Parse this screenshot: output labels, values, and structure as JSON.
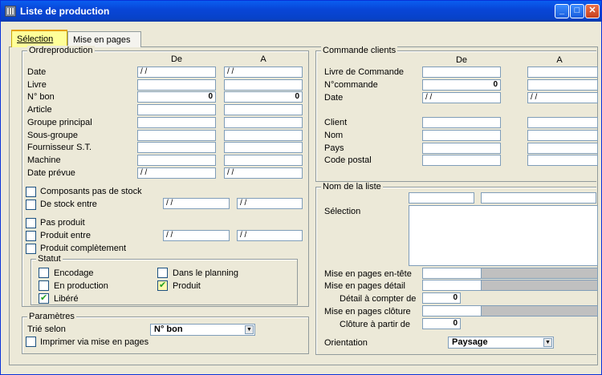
{
  "window": {
    "title": "Liste de production",
    "min": "_",
    "max": "□",
    "close": "✕"
  },
  "tabs": [
    {
      "label": "Sélection"
    },
    {
      "label": "Mise en pages"
    }
  ],
  "ordre": {
    "title": "Ordreproduction",
    "col_de": "De",
    "col_a": "A",
    "rows": [
      {
        "label": "Date",
        "de": " /  /",
        "a": " /  /"
      },
      {
        "label": "Livre",
        "de": "",
        "a": ""
      },
      {
        "label": "N° bon",
        "de": "0",
        "a": "0"
      },
      {
        "label": "Article",
        "de": "",
        "a": ""
      },
      {
        "label": "Groupe principal",
        "de": "",
        "a": ""
      },
      {
        "label": "Sous-groupe",
        "de": "",
        "a": ""
      },
      {
        "label": "Fournisseur S.T.",
        "de": "",
        "a": ""
      },
      {
        "label": "Machine",
        "de": "",
        "a": ""
      },
      {
        "label": "Date prévue",
        "de": " /  /",
        "a": " /  /"
      }
    ],
    "composants": "Composants pas de stock",
    "destock": "De stock entre",
    "destock_de": " /  /",
    "destock_a": " /  /",
    "pasproduit": "Pas produit",
    "produitentre": "Produit entre",
    "produitentre_de": " /  /",
    "produitentre_a": " /  /",
    "complet": "Produit complètement",
    "statut": {
      "title": "Statut",
      "encodage": "Encodage",
      "planning": "Dans le planning",
      "enproduction": "En production",
      "produit": "Produit",
      "libere": "Libéré"
    }
  },
  "params": {
    "title": "Paramètres",
    "trie_label": "Trié selon",
    "trie_value": "N° bon",
    "imprimer": "Imprimer via mise en pages"
  },
  "commande": {
    "title": "Commande clients",
    "col_de": "De",
    "col_a": "A",
    "rows": [
      {
        "label": "Livre de Commande",
        "de": "",
        "a": ""
      },
      {
        "label": "N°commande",
        "de": "0",
        "a": ""
      },
      {
        "label": "Date",
        "de": " /  /",
        "a": " /  /"
      },
      {
        "label": "Client",
        "de": "",
        "a": ""
      },
      {
        "label": "Nom",
        "de": "",
        "a": ""
      },
      {
        "label": "Pays",
        "de": "",
        "a": ""
      },
      {
        "label": "Code postal",
        "de": "",
        "a": ""
      }
    ]
  },
  "liste": {
    "title": "Nom de la liste",
    "selection": "Sélection",
    "entete": "Mise en pages en-tête",
    "detail": "Mise en pages détail",
    "detail_compter": "Détail à compter de",
    "detail_compter_val": "0",
    "cloture": "Mise en pages clôture",
    "cloture_partir": "Clôture à partir de",
    "cloture_partir_val": "0",
    "orientation": "Orientation",
    "orientation_val": "Paysage"
  }
}
